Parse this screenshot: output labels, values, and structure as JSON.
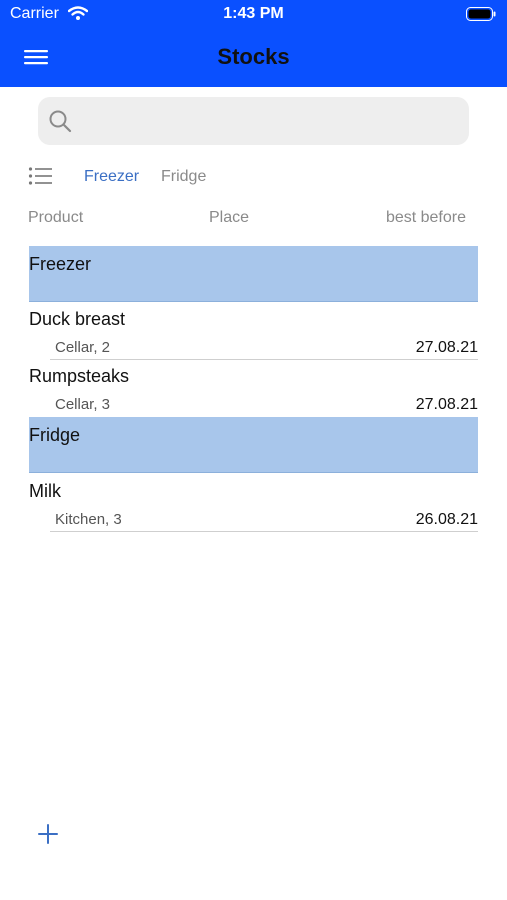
{
  "status_bar": {
    "carrier": "Carrier",
    "time": "1:43 PM"
  },
  "nav": {
    "title": "Stocks"
  },
  "search": {
    "value": "",
    "placeholder": ""
  },
  "filters": [
    {
      "label": "Freezer",
      "active": true
    },
    {
      "label": "Fridge",
      "active": false
    }
  ],
  "columns": {
    "product": "Product",
    "place": "Place",
    "best_before": "best before"
  },
  "sections": [
    {
      "title": "Freezer",
      "items": [
        {
          "name": "Duck breast",
          "place": "Cellar, 2",
          "date": "27.08.21"
        },
        {
          "name": "Rumpsteaks",
          "place": "Cellar, 3",
          "date": "27.08.21"
        }
      ]
    },
    {
      "title": "Fridge",
      "items": [
        {
          "name": "Milk",
          "place": "Kitchen, 3",
          "date": "26.08.21"
        }
      ]
    }
  ],
  "colors": {
    "header": "#0a50ff",
    "section_bg": "#a8c6eb",
    "accent": "#3b6fc4"
  },
  "icons": {
    "menu": "hamburger-menu-icon",
    "search": "search-icon",
    "list": "list-icon",
    "add": "plus-icon"
  }
}
